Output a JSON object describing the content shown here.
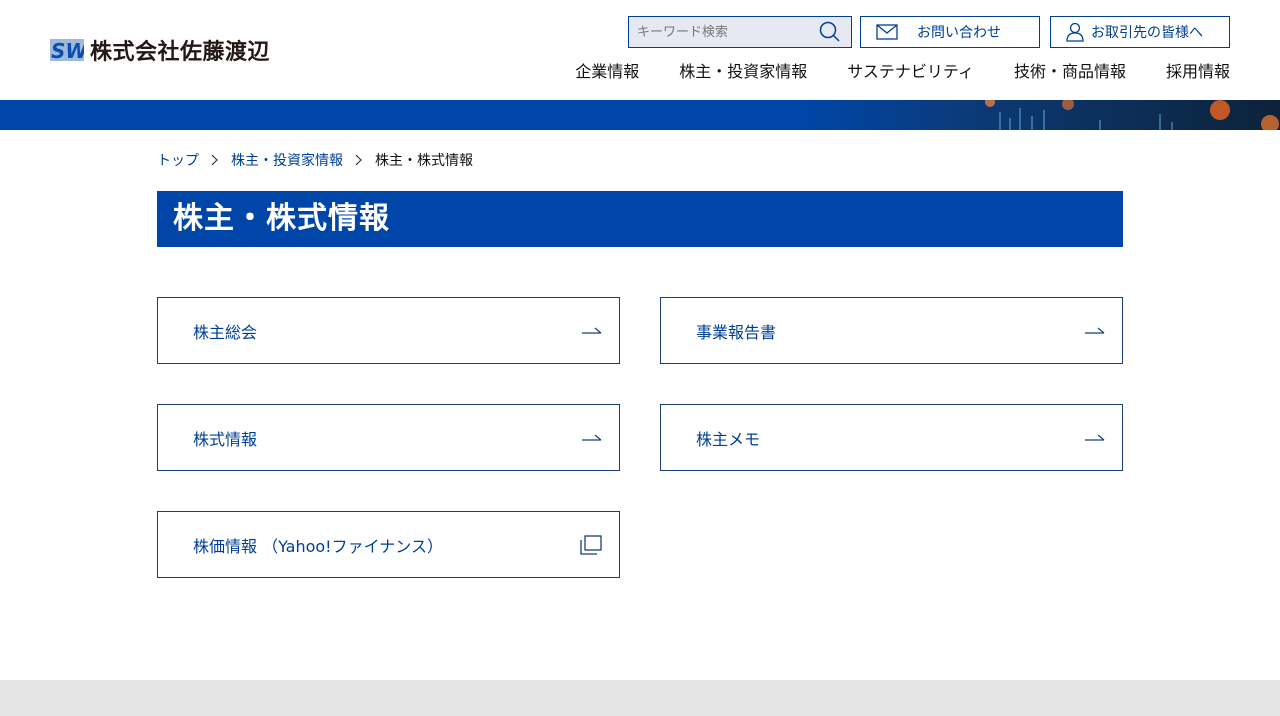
{
  "header": {
    "logo_text": "株式会社佐藤渡辺",
    "search": {
      "placeholder": "キーワード検索",
      "value": ""
    },
    "contact_label": "お問い合わせ",
    "partner_label": "お取引先の皆様へ",
    "nav": [
      "企業情報",
      "株主・投資家情報",
      "サステナビリティ",
      "技術・商品情報",
      "採用情報"
    ]
  },
  "breadcrumb": {
    "items": [
      "トップ",
      "株主・投資家情報"
    ],
    "current": "株主・株式情報"
  },
  "main": {
    "title": "株主・株式情報",
    "links": [
      {
        "label": "株主総会",
        "icon": "arrow-right-icon"
      },
      {
        "label": "事業報告書",
        "icon": "arrow-right-icon"
      },
      {
        "label": "株式情報",
        "icon": "arrow-right-icon"
      },
      {
        "label": "株主メモ",
        "icon": "arrow-right-icon"
      },
      {
        "label": "株価情報 （Yahoo!ファイナンス）",
        "icon": "external-window-icon"
      }
    ]
  },
  "colors": {
    "brand_blue": "#0046a8",
    "link_blue": "#003f98",
    "footer_gray": "#e5e5e5"
  }
}
